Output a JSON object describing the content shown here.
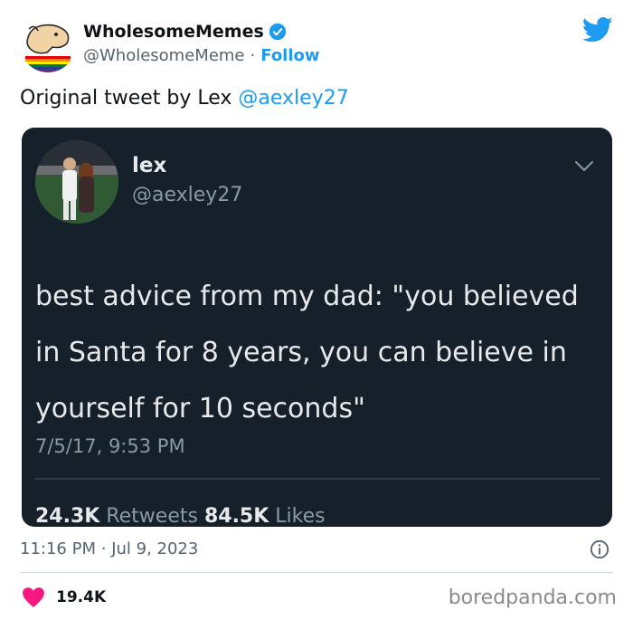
{
  "account": {
    "display_name": "WholesomeMemes",
    "handle": "@WholesomeMeme",
    "separator": "·",
    "follow_label": "Follow"
  },
  "tweet": {
    "text_prefix": "Original tweet by Lex ",
    "mention": "@aexley27"
  },
  "embedded_tweet": {
    "name": "lex",
    "handle": "@aexley27",
    "body": "best advice from my dad: \"you believed in Santa for 8 years, you can believe in yourself for 10 seconds\"",
    "timestamp": "7/5/17, 9:53 PM",
    "retweets_count": "24.3K",
    "retweets_label": "Retweets",
    "likes_count": "84.5K",
    "likes_label": "Likes"
  },
  "meta": {
    "time": "11:16 PM",
    "separator": "·",
    "date": "Jul 9, 2023"
  },
  "engagement": {
    "likes": "19.4K"
  },
  "watermark": "boredpanda.com",
  "colors": {
    "accent": "#1d9bf0",
    "heart": "#f91880",
    "embed_bg": "#15202b"
  },
  "icons": [
    "verified-badge-icon",
    "twitter-bird-icon",
    "chevron-down-icon",
    "info-icon",
    "heart-icon"
  ]
}
